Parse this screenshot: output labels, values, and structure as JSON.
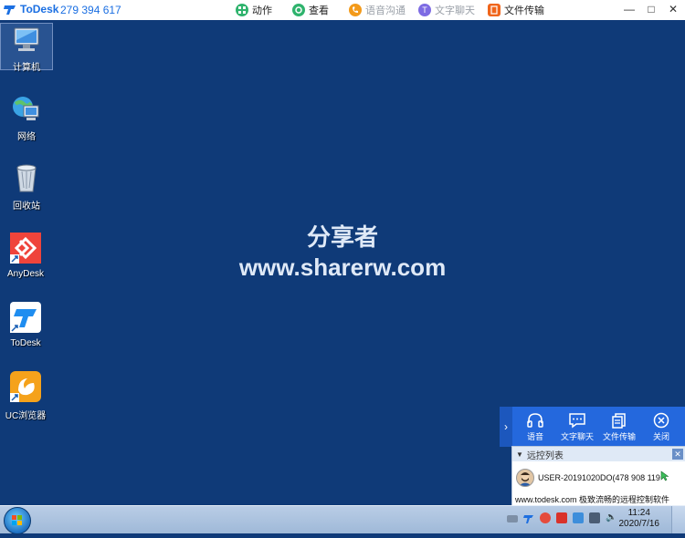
{
  "titlebar": {
    "app_name": "ToDesk",
    "device_id": "279 394 617",
    "actions": [
      {
        "label": "动作",
        "icon": "action-icon",
        "color": "#2fb36d"
      },
      {
        "label": "查看",
        "icon": "view-icon",
        "color": "#2fb36d"
      },
      {
        "label": "语音沟通",
        "icon": "voice-icon",
        "color": "#f39a1a"
      },
      {
        "label": "文字聊天",
        "icon": "text-chat-icon",
        "color": "#7d6be3"
      },
      {
        "label": "文件传输",
        "icon": "file-transfer-icon",
        "color": "#f0651b"
      }
    ]
  },
  "desktop": {
    "icons": [
      {
        "label": "计算机",
        "icon": "computer-icon"
      },
      {
        "label": "网络",
        "icon": "network-icon"
      },
      {
        "label": "回收站",
        "icon": "recycle-bin-icon"
      },
      {
        "label": "AnyDesk",
        "icon": "anydesk-icon"
      },
      {
        "label": "ToDesk",
        "icon": "todesk-icon"
      },
      {
        "label": "UC浏览器",
        "icon": "uc-browser-icon"
      }
    ],
    "watermark_line1": "分享者",
    "watermark_line2": "www.sharerw.com"
  },
  "remote_panel": {
    "buttons": [
      {
        "label": "语音",
        "icon": "headset-icon"
      },
      {
        "label": "文字聊天",
        "icon": "chat-icon"
      },
      {
        "label": "文件传输",
        "icon": "file-icon"
      },
      {
        "label": "关闭",
        "icon": "close-icon"
      }
    ],
    "list_title": "远控列表",
    "user_entry": "USER-20191020DO(478 908 119",
    "footer": "www.todesk.com 极致流畅的远程控制软件"
  },
  "taskbar": {
    "time": "11:24",
    "date": "2020/7/16"
  },
  "colors": {
    "desktop_bg": "#0f3a78",
    "panel_blue": "#2468dd",
    "brand_blue": "#1b6fe2"
  }
}
